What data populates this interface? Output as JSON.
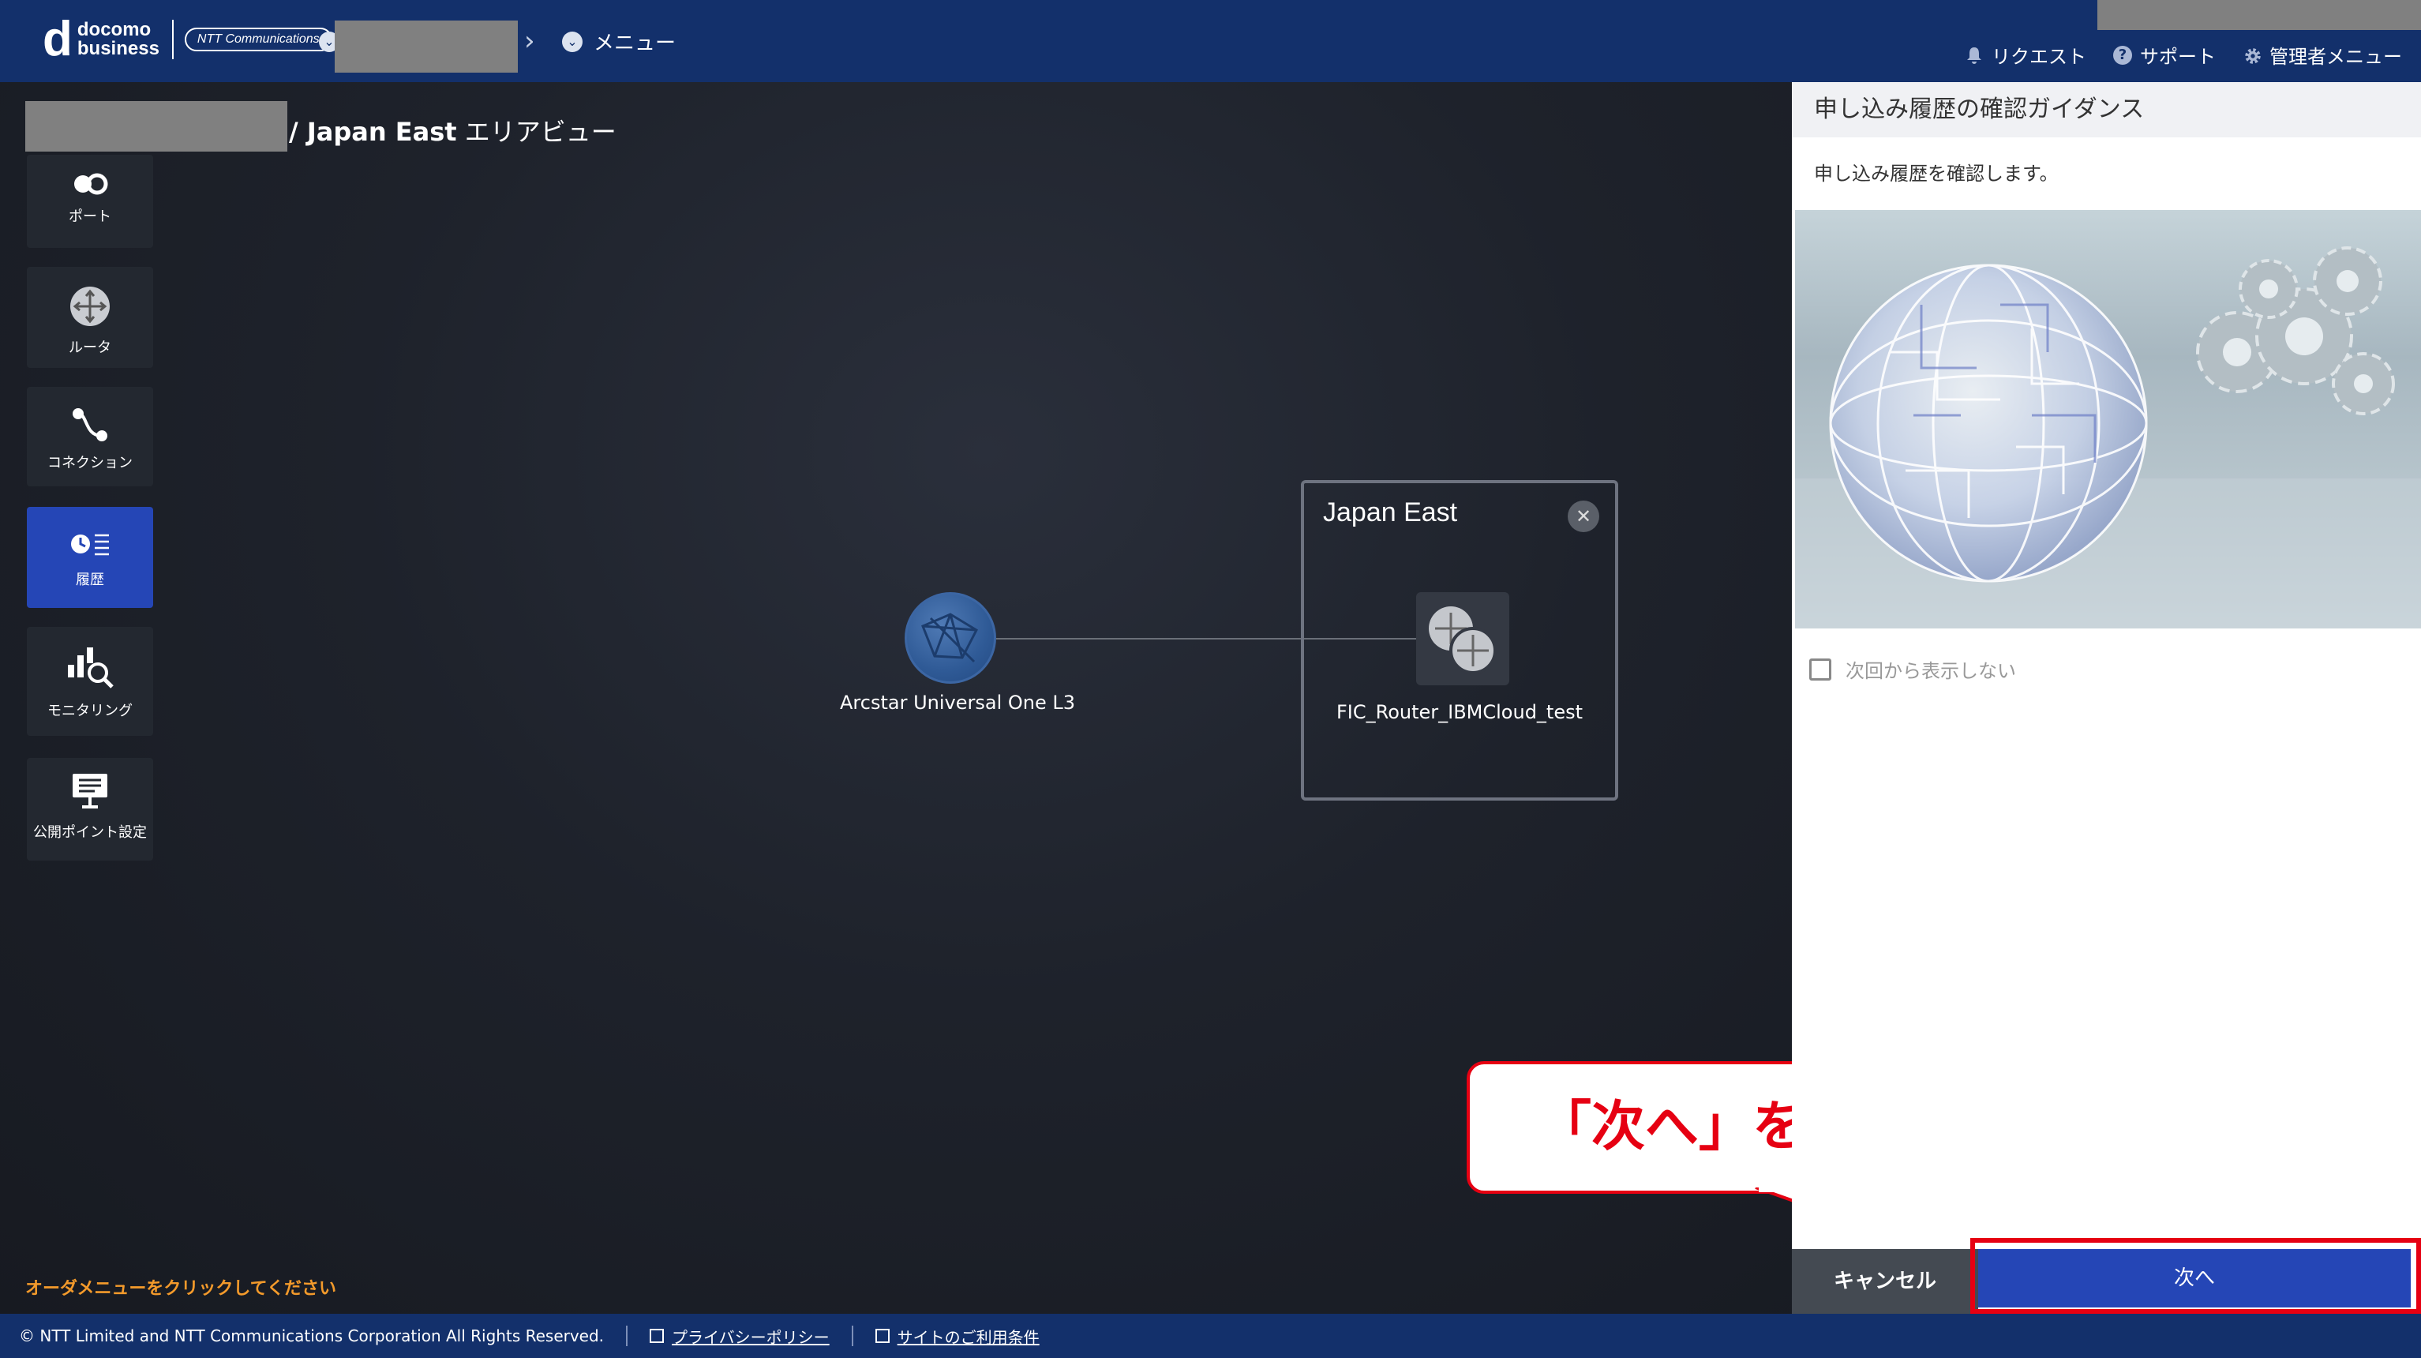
{
  "header": {
    "logo": {
      "brand_top": "docomo",
      "brand_bottom": "business",
      "ntt": "NTT Communications"
    },
    "tenant_icon": "chevron-down-circle-icon",
    "breadcrumb_chevron": "chevron-right-icon",
    "menu_label": "メニュー",
    "links": [
      {
        "label": "リクエスト",
        "icon": "bell-icon"
      },
      {
        "label": "サポート",
        "icon": "question-circle-icon"
      },
      {
        "label": "管理者メニュー",
        "icon": "gear-icon"
      }
    ]
  },
  "canvas": {
    "breadcrumb_bold": "/ Japan East",
    "breadcrumb_rest": " エリアビュー",
    "sidebar": [
      {
        "label": "ポート",
        "icon": "port-icon"
      },
      {
        "label": "ルータ",
        "icon": "router-icon"
      },
      {
        "label": "コネクション",
        "icon": "connection-icon"
      },
      {
        "label": "履歴",
        "icon": "history-icon",
        "active": true
      },
      {
        "label": "モニタリング",
        "icon": "monitoring-icon"
      },
      {
        "label": "公開ポイント設定",
        "icon": "public-point-icon"
      }
    ],
    "node_globe_label": "Arcstar Universal One L3",
    "area": {
      "title": "Japan East",
      "router_label": "FIC_Router_IBMCloud_test"
    },
    "order_message": "オーダメニューをクリックしてください"
  },
  "callout": {
    "text": "「次へ」を選択",
    "border_color": "#e60012"
  },
  "panel": {
    "title": "申し込み履歴の確認ガイダンス",
    "description": "申し込み履歴を確認します。",
    "checkbox_label": "次回から表示しない",
    "checkbox_checked": false,
    "cancel_label": "キャンセル",
    "next_label": "次へ"
  },
  "footer": {
    "copyright": "© NTT Limited and NTT Communications Corporation All Rights Reserved.",
    "links": [
      "プライバシーポリシー",
      "サイトのご利用条件"
    ]
  },
  "colors": {
    "header_bg": "#13306b",
    "accent_blue": "#2546b6",
    "highlight_red": "#e60012",
    "warning_orange": "#f39a2b"
  }
}
